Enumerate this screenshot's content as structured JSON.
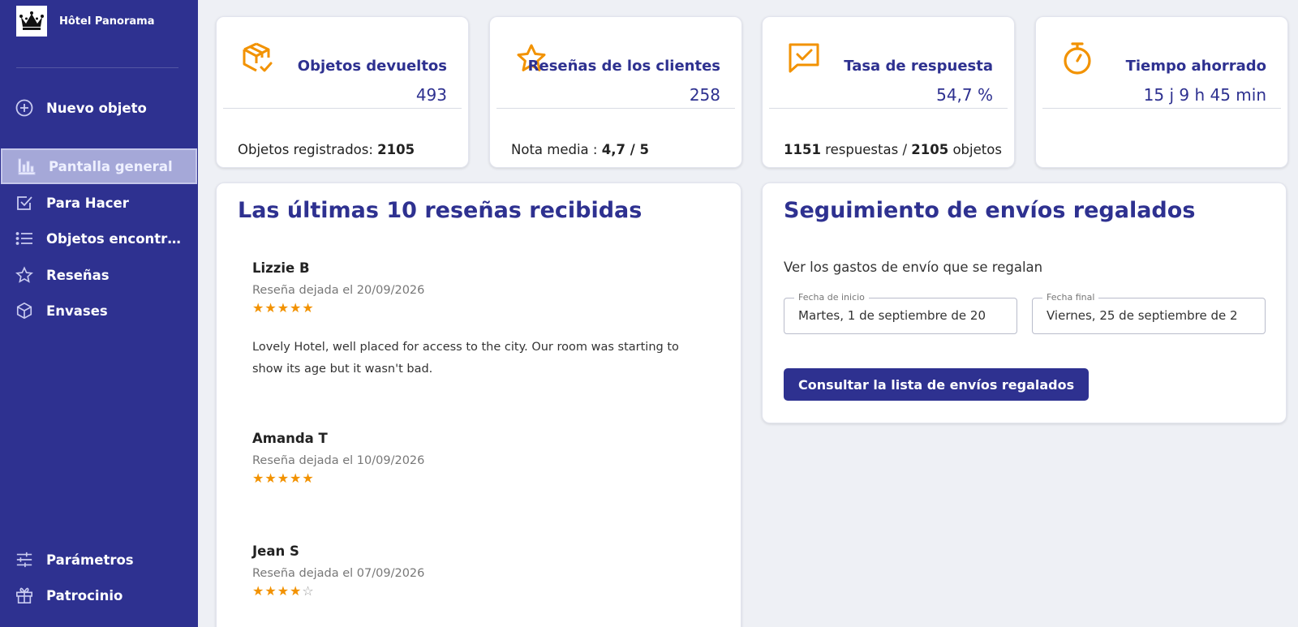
{
  "sidebar": {
    "brand": "Hôtel Panorama",
    "items": [
      {
        "label": "Nuevo objeto",
        "icon": "add-circle-icon"
      },
      {
        "label": "Pantalla general",
        "icon": "bar-chart-icon",
        "active": true
      },
      {
        "label": "Para Hacer",
        "icon": "checkbox-icon"
      },
      {
        "label": "Objetos encontrados",
        "icon": "list-icon"
      },
      {
        "label": "Reseñas",
        "icon": "star-icon"
      },
      {
        "label": "Envases",
        "icon": "package-icon"
      }
    ],
    "bottom_items": [
      {
        "label": "Parámetros",
        "icon": "sliders-icon"
      },
      {
        "label": "Patrocinio",
        "icon": "gift-icon"
      }
    ]
  },
  "stats": [
    {
      "title": "Objetos devueltos",
      "value": "493",
      "icon": "package-check-icon",
      "foot_prefix": "Objetos registrados: ",
      "foot_bold": "2105"
    },
    {
      "title": "Reseñas de los clientes",
      "value": "258",
      "icon": "star-outline-icon",
      "foot_prefix": "Nota media : ",
      "foot_bold": "4,7 / 5"
    },
    {
      "title": "Tasa de respuesta",
      "value": "54,7 %",
      "icon": "message-check-icon",
      "foot_bold1": "1151",
      "foot_mid": " respuestas / ",
      "foot_bold2": "2105",
      "foot_suffix": " objetos"
    },
    {
      "title": "Tiempo ahorrado",
      "value": "15 j 9 h 45 min",
      "icon": "stopwatch-icon"
    }
  ],
  "reviews_panel": {
    "title": "Las últimas 10 reseñas recibidas",
    "reviews": [
      {
        "author": "Lizzie B",
        "date": "Reseña dejada el 20/09/2026",
        "rating": 5,
        "text": "Lovely Hotel, well placed for access to the city. Our room was starting to show its age but it wasn't bad."
      },
      {
        "author": "Amanda T",
        "date": "Reseña dejada el 10/09/2026",
        "rating": 5,
        "text": ""
      },
      {
        "author": "Jean S",
        "date": "Reseña dejada el 07/09/2026",
        "rating": 4,
        "text": ""
      }
    ]
  },
  "shipping_panel": {
    "title": "Seguimiento de envíos regalados",
    "subtitle": "Ver los gastos de envío que se regalan",
    "start_label": "Fecha de inicio",
    "start_value": "Martes, 1 de septiembre de 20",
    "end_label": "Fecha final",
    "end_value": "Viernes, 25 de septiembre de 2",
    "button": "Consultar la lista de envíos regalados"
  },
  "colors": {
    "sidebar": "#2e3190",
    "accent": "#2e3190",
    "icon_orange": "#f29200",
    "star": "#f29200",
    "background": "#eef0f5"
  }
}
